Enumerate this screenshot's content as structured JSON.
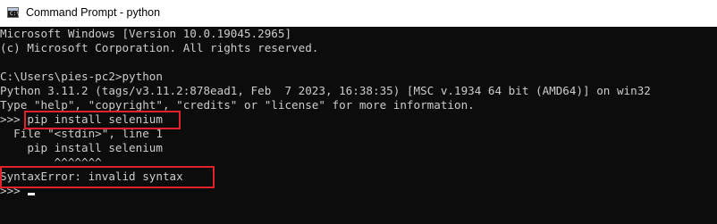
{
  "window": {
    "title": "Command Prompt - python",
    "icon": "cmd-icon",
    "icon_prompt": "C:\\"
  },
  "console": {
    "lines": [
      "Microsoft Windows [Version 10.0.19045.2965]",
      "(c) Microsoft Corporation. All rights reserved.",
      "",
      "C:\\Users\\pies-pc2>python",
      "Python 3.11.2 (tags/v3.11.2:878ead1, Feb  7 2023, 16:38:35) [MSC v.1934 64 bit (AMD64)] on win32",
      "Type \"help\", \"copyright\", \"credits\" or \"license\" for more information.",
      ">>> pip install selenium",
      "  File \"<stdin>\", line 1",
      "    pip install selenium",
      "        ^^^^^^^",
      "SyntaxError: invalid syntax",
      ">>> "
    ]
  },
  "colors": {
    "console_background": "#0c0c0c",
    "console_text": "#cccccc",
    "highlight_border": "#e2212b"
  }
}
